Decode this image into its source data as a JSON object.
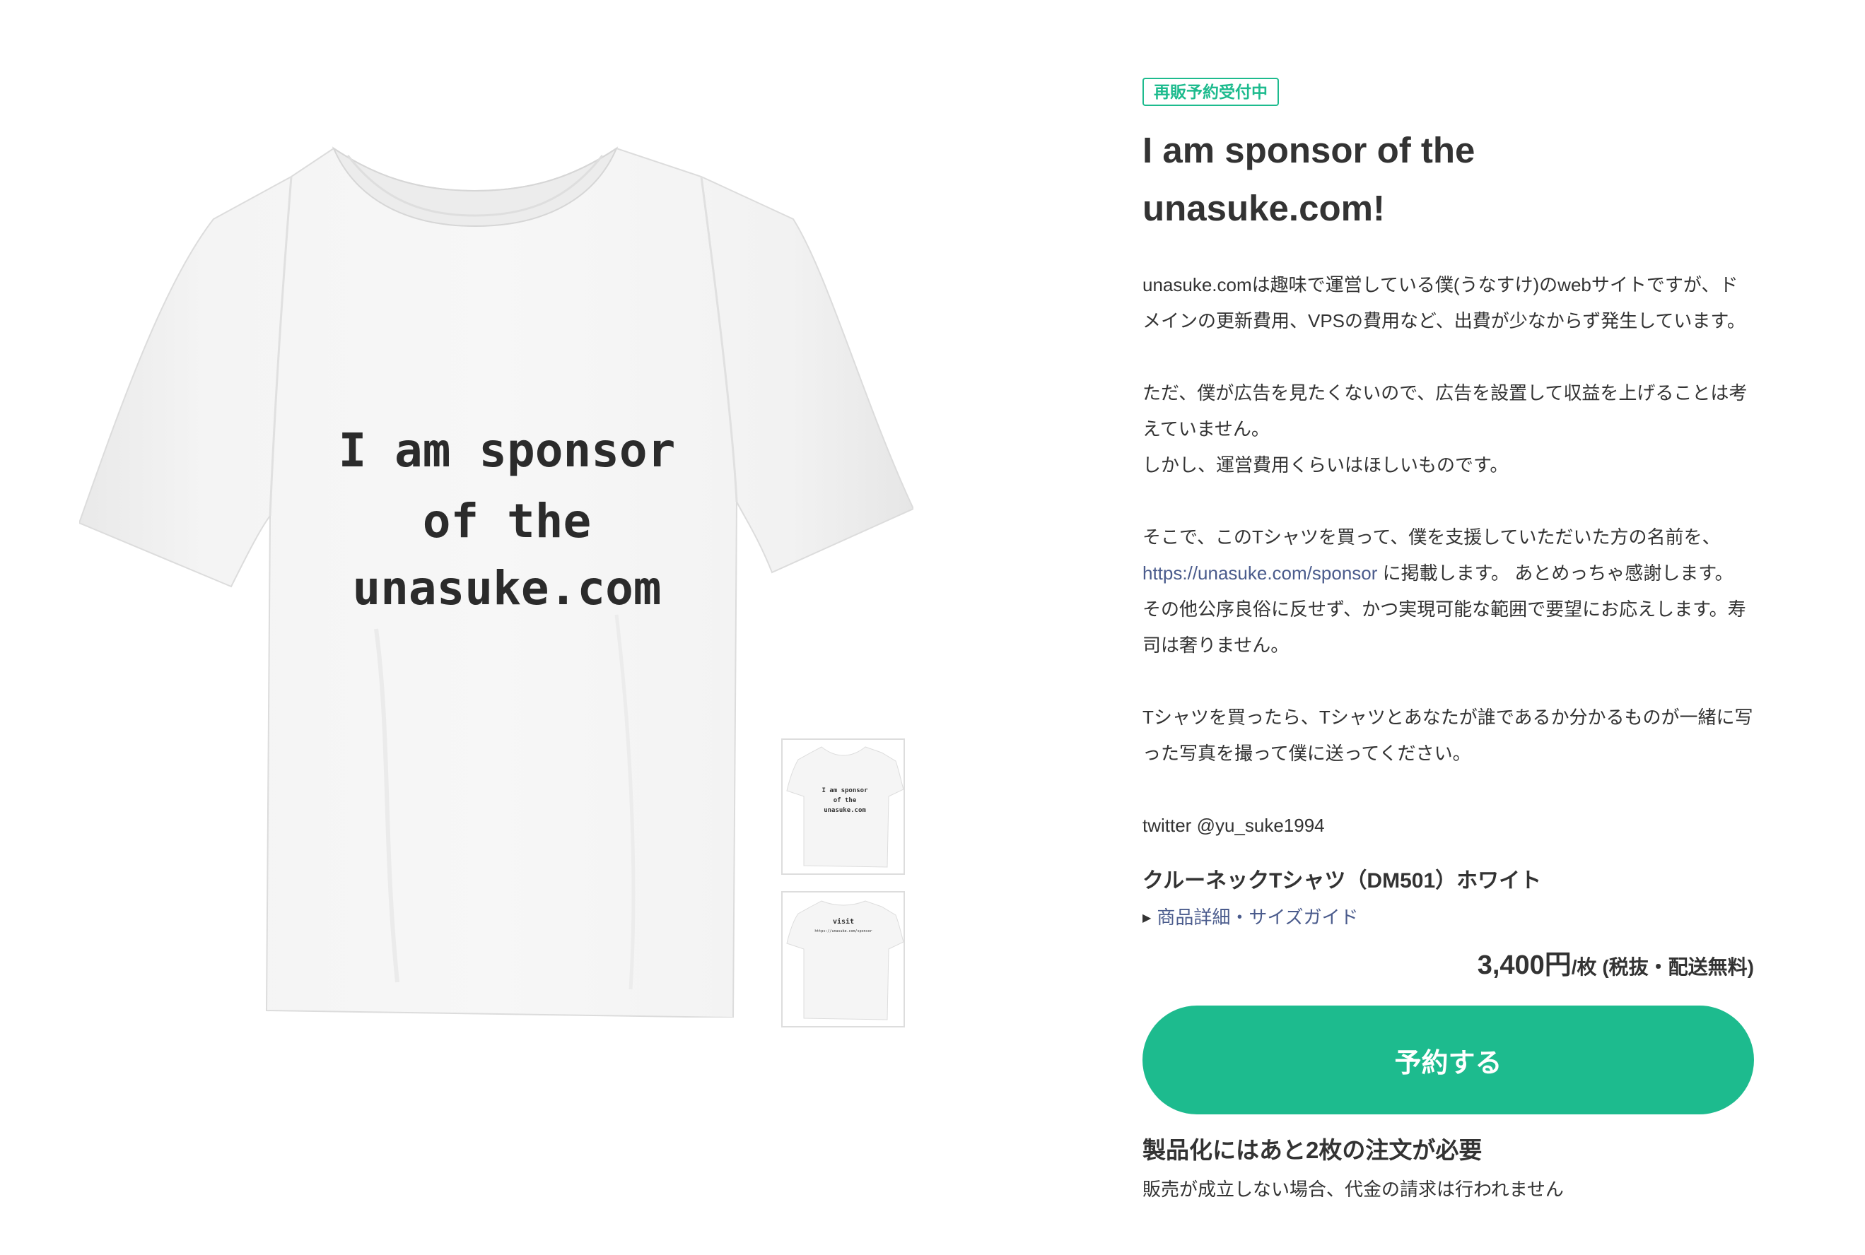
{
  "product": {
    "status_badge": "再販予約受付中",
    "title_line1": "I am sponsor of the",
    "title_line2": "unasuke.com!",
    "description": {
      "p1": "unasuke.comは趣味で運営している僕(うなすけ)のwebサイトですが、ドメインの更新費用、VPSの費用など、出費が少なからず発生しています。",
      "p2_line1": "ただ、僕が広告を見たくないので、広告を設置して収益を上げることは考えていません。",
      "p2_line2": "しかし、運営費用くらいはほしいものです。",
      "p3_before": "そこで、このTシャツを買って、僕を支援していただいた方の名前を、",
      "p3_link": "https://unasuke.com/sponsor",
      "p3_after": " に掲載します。 あとめっちゃ感謝します。 その他公序良俗に反せず、かつ実現可能な範囲で要望にお応えします。寿司は奢りません。",
      "p4": "Tシャツを買ったら、Tシャツとあなたが誰であるか分かるものが一緒に写った写真を撮って僕に送ってください。",
      "p5": "twitter @yu_suke1994"
    },
    "item_name": "クルーネックTシャツ（DM501）ホワイト",
    "detail_link": "商品詳細・サイズガイド",
    "price": {
      "amount": "3,400円",
      "unit": "/枚",
      "note": " (税抜・配送無料)"
    },
    "reserve_button": "予約する",
    "requirement": "製品化にはあと2枚の注文が必要",
    "sub_note": "販売が成立しない場合、代金の請求は行われません"
  },
  "images": {
    "shirt_print": {
      "line1": "I am sponsor",
      "line2": "of the",
      "line3": "unasuke.com"
    },
    "back_print": {
      "line1": "visit",
      "line2": "https://unasuke.com/sponsor"
    },
    "icons": {
      "main": "tshirt-front-image",
      "thumb_front": "tshirt-front-thumbnail",
      "thumb_back": "tshirt-back-thumbnail",
      "detail_caret": "caret-right-icon"
    }
  },
  "colors": {
    "accent": "#1dbb8e",
    "link": "#4a5b8c",
    "text": "#333333",
    "shirt": "#f3f3f3"
  }
}
